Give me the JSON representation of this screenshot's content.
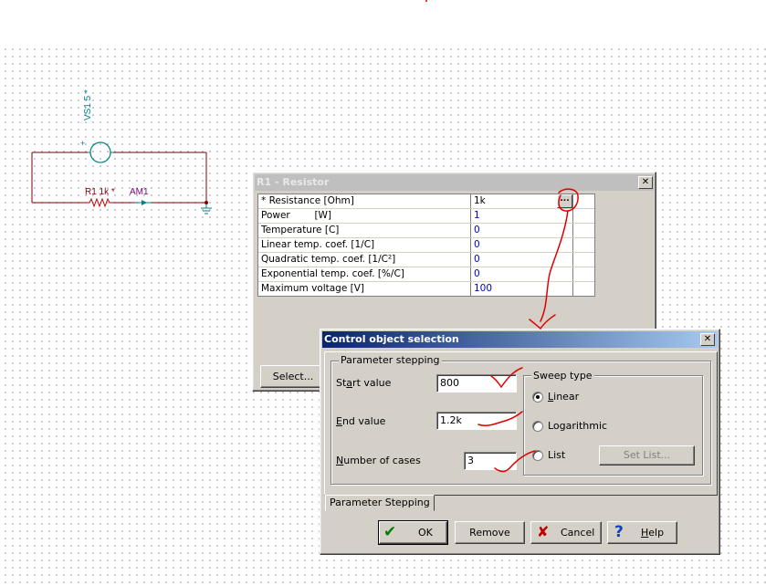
{
  "circuit": {
    "source_label": "VS1 5 *",
    "resistor_label": "R1 1k *",
    "ammeter_label": "AM1",
    "plus": "+"
  },
  "resistor_dialog": {
    "title": "R1 - Resistor",
    "close": "✕",
    "browse": "...",
    "select_button": "Select...",
    "params": [
      {
        "name": "* Resistance [Ohm]",
        "value": "1k"
      },
      {
        "name": "Power        [W]",
        "value": "1"
      },
      {
        "name": "Temperature [C]",
        "value": "0"
      },
      {
        "name": "Linear temp. coef. [1/C]",
        "value": "0"
      },
      {
        "name": "Quadratic temp. coef. [1/C²]",
        "value": "0"
      },
      {
        "name": "Exponential temp. coef. [%/C]",
        "value": "0"
      },
      {
        "name": "Maximum voltage [V]",
        "value": "100"
      }
    ]
  },
  "control_dialog": {
    "title": "Control object selection",
    "close": "✕",
    "group_label": "Parameter stepping",
    "start": {
      "label_pre": "St",
      "label_u": "a",
      "label_post": "rt value",
      "value": "800"
    },
    "end": {
      "label_pre": "",
      "label_u": "E",
      "label_post": "nd value",
      "value": "1.2k"
    },
    "cases": {
      "label_pre": "",
      "label_u": "N",
      "label_post": "umber of cases",
      "value": "3"
    },
    "sweep": {
      "label": "Sweep type",
      "selected": "Linear",
      "options": [
        {
          "u": "L",
          "rest": "inear"
        },
        {
          "u": "",
          "rest": "Logarithmic"
        },
        {
          "u": "",
          "rest": "List"
        }
      ],
      "set_list": "Set List..."
    },
    "tab": "Parameter Stepping",
    "buttons": {
      "ok": "OK",
      "remove": "Remove",
      "cancel": "Cancel",
      "help_u": "H",
      "help_rest": "elp"
    }
  },
  "colors": {
    "title_active": "#0a246a",
    "wire": "#800000",
    "component": "#008080",
    "annotation": "#e00000",
    "value_text": "#0000c0"
  }
}
